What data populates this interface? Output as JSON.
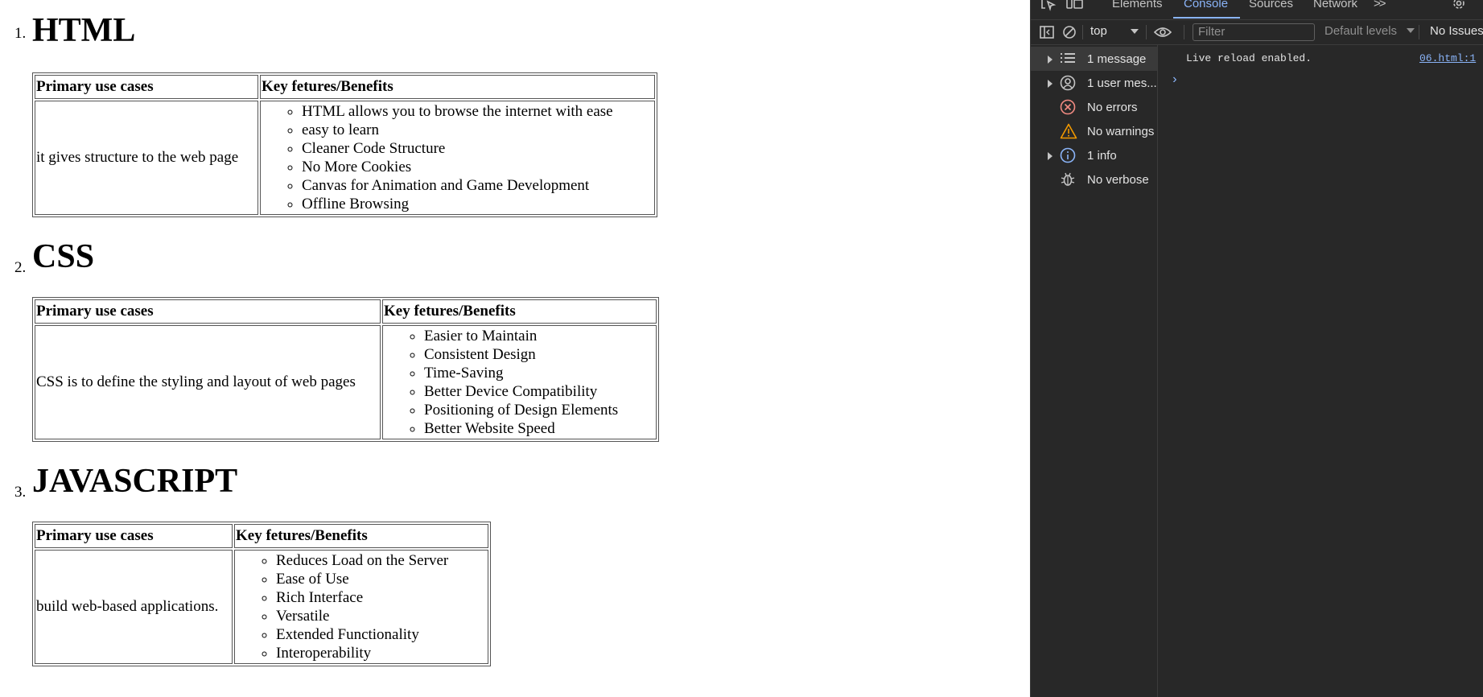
{
  "sections": [
    {
      "number": "1.",
      "title": "HTML",
      "header_use": "Primary use cases",
      "header_features": "Key fetures/Benefits",
      "use_case": "it gives structure to the web page",
      "features": [
        "HTML allows you to browse the internet with ease",
        "easy to learn",
        "Cleaner Code Structure",
        "No More Cookies",
        "Canvas for Animation and Game Development",
        "Offline Browsing"
      ]
    },
    {
      "number": "2.",
      "title": "CSS",
      "header_use": "Primary use cases",
      "header_features": "Key fetures/Benefits",
      "use_case": "CSS is to define the styling and layout of web pages",
      "features": [
        "Easier to Maintain",
        "Consistent Design",
        "Time-Saving",
        "Better Device Compatibility",
        "Positioning of Design Elements",
        "Better Website Speed"
      ]
    },
    {
      "number": "3.",
      "title": "JAVASCRIPT",
      "header_use": "Primary use cases",
      "header_features": "Key fetures/Benefits",
      "use_case": "build web-based applications.",
      "features": [
        "Reduces Load on the Server",
        "Ease of Use",
        "Rich Interface",
        "Versatile",
        "Extended Functionality",
        "Interoperability"
      ]
    }
  ],
  "devtools": {
    "tabs": {
      "elements": "Elements",
      "console": "Console",
      "sources": "Sources",
      "network": "Network",
      "more": ">>"
    },
    "toolbar": {
      "context": "top",
      "filter_placeholder": "Filter",
      "levels": "Default levels",
      "issues": "No Issues"
    },
    "sidebar": {
      "messages": "1 message",
      "user_messages": "1 user mes...",
      "errors": "No errors",
      "warnings": "No warnings",
      "info": "1 info",
      "verbose": "No verbose"
    },
    "log": {
      "text": "Live reload enabled.",
      "source": "06.html:1"
    },
    "prompt": "›",
    "colors": {
      "background": "#282828",
      "accent": "#8ab4f8",
      "error": "#f28b82",
      "warning": "#f29900",
      "info": "#8ab4f8"
    }
  }
}
